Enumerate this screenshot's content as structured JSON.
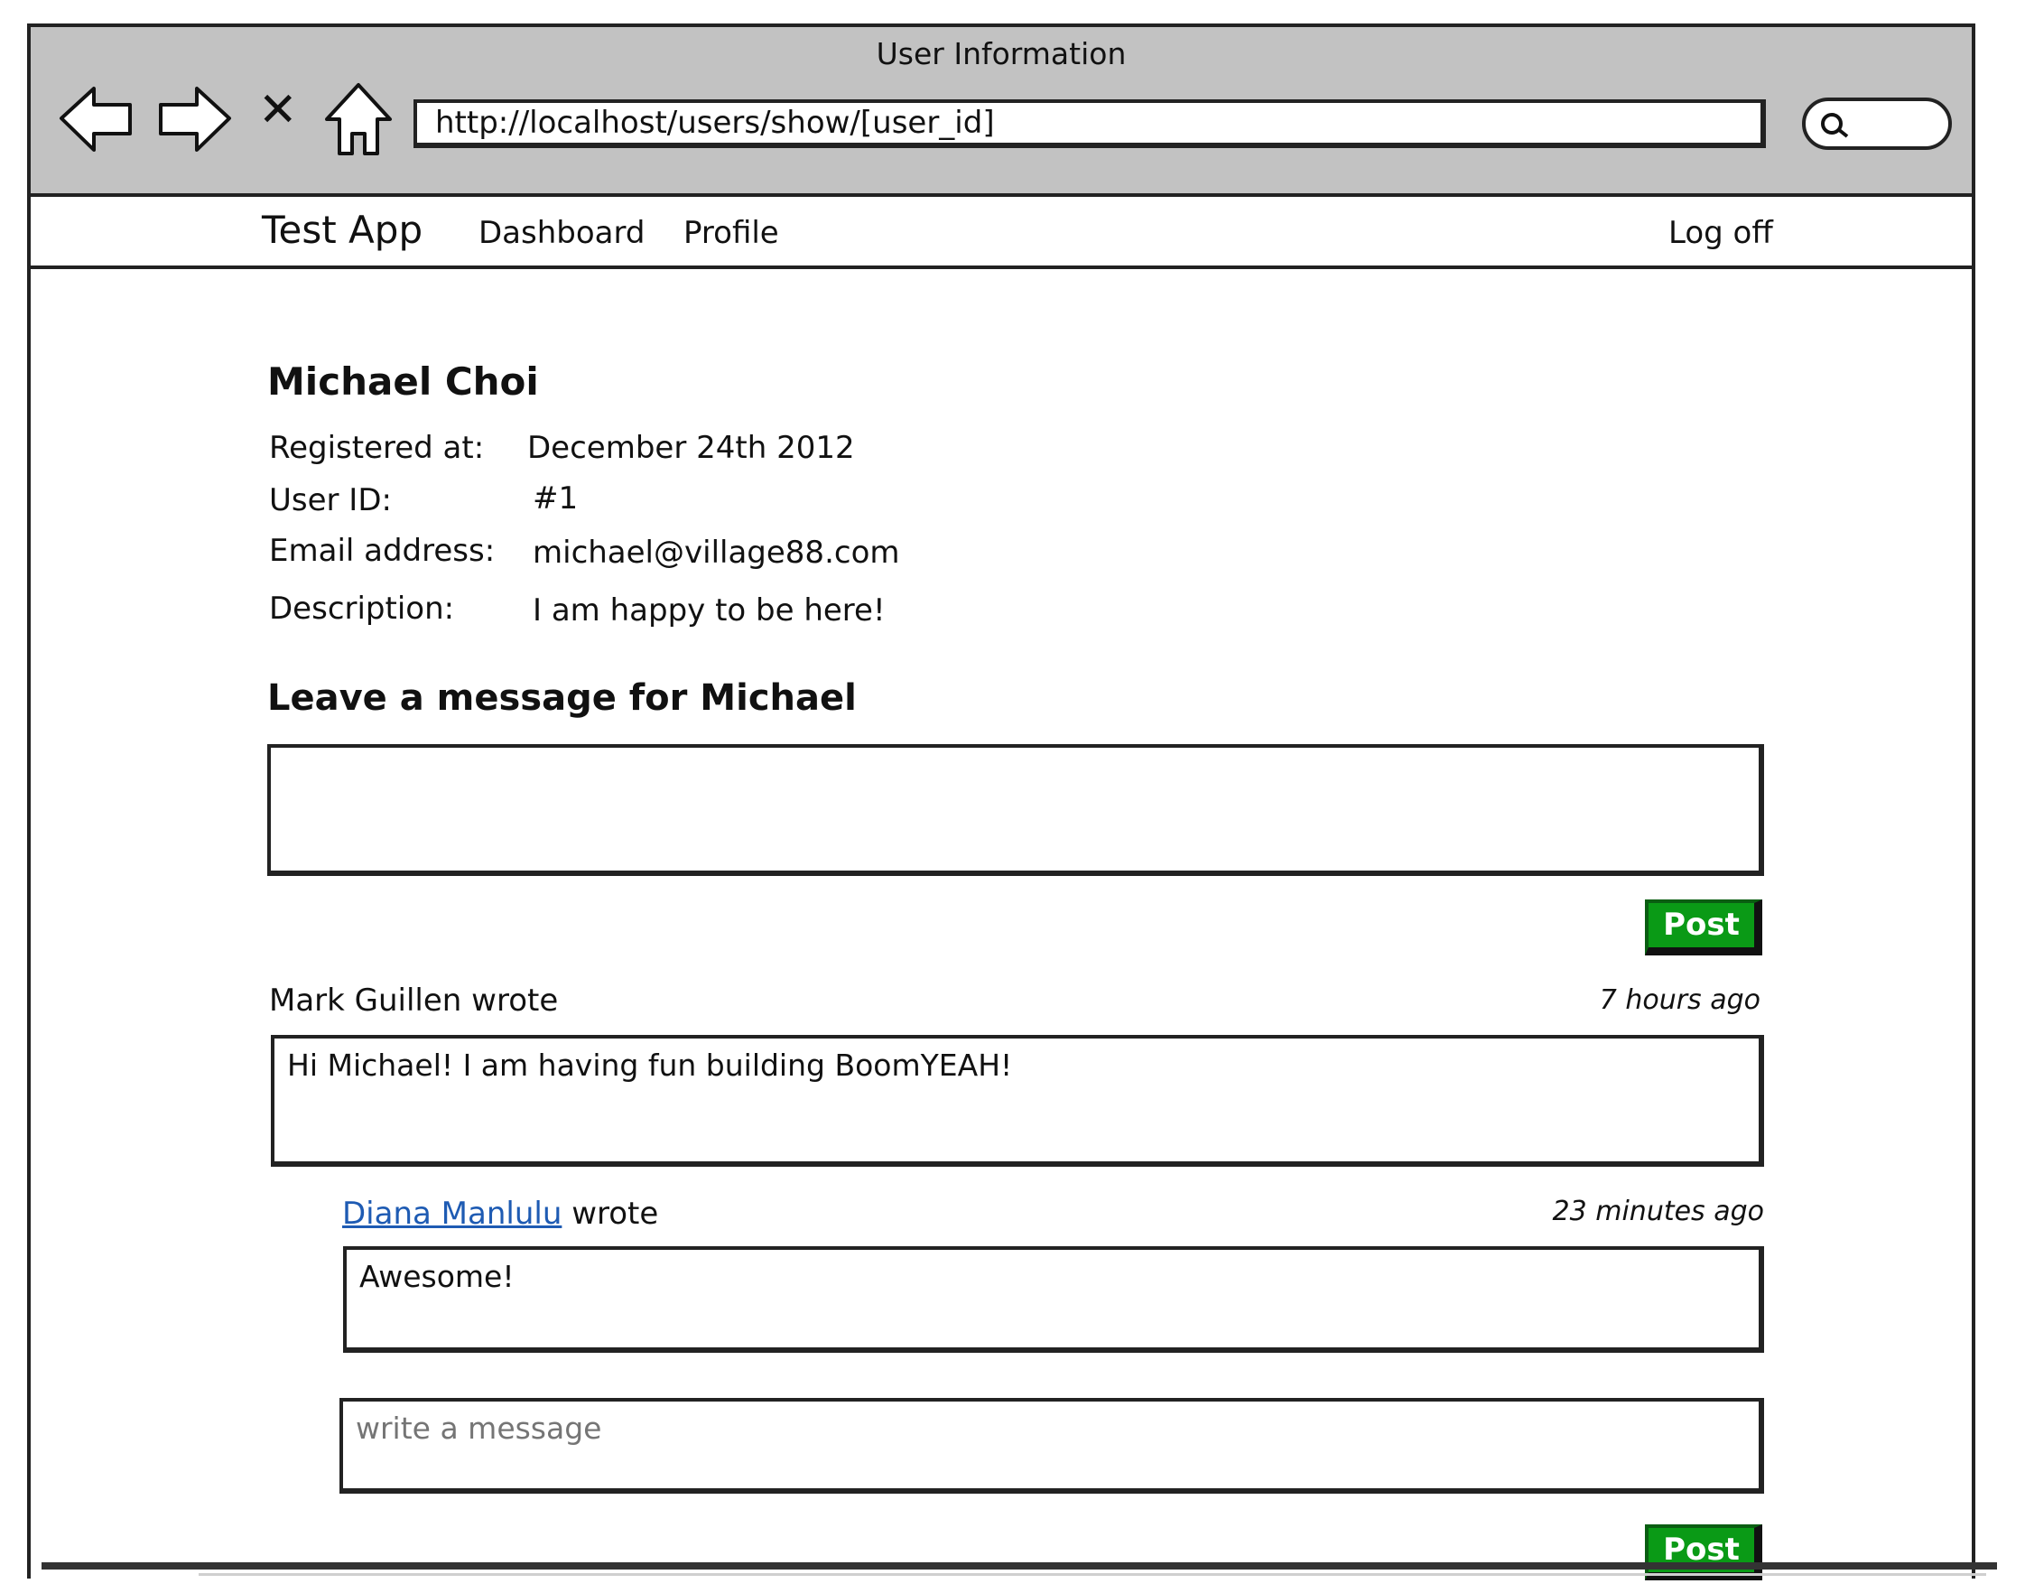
{
  "browser": {
    "window_title": "User Information",
    "url": "http://localhost/users/show/[user_id]",
    "icons": [
      "back-arrow-icon",
      "forward-arrow-icon",
      "close-icon",
      "home-icon",
      "search-icon"
    ]
  },
  "navbar": {
    "brand": "Test App",
    "links": [
      "Dashboard",
      "Profile"
    ],
    "logoff": "Log off"
  },
  "user": {
    "name": "Michael Choi",
    "fields": [
      {
        "label": "Registered at:",
        "value": "December 24th 2012"
      },
      {
        "label": "User ID:",
        "value": "#1"
      },
      {
        "label": "Email address:",
        "value": "michael@village88.com"
      },
      {
        "label": "Description:",
        "value": "I am happy to be here!"
      }
    ]
  },
  "message_form": {
    "heading": "Leave a message for Michael",
    "value": "",
    "post_label": "Post"
  },
  "messages": [
    {
      "author": "Mark Guillen",
      "wrote": "wrote",
      "time": "7 hours ago",
      "text": "Hi Michael! I am having fun building BoomYEAH!",
      "comments": [
        {
          "author": "Diana Manlulu",
          "wrote": "wrote",
          "time": "23 minutes ago",
          "text": "Awesome!"
        }
      ],
      "reply": {
        "placeholder": "write a message",
        "post_label": "Post"
      }
    }
  ],
  "colors": {
    "chrome": "#c2c2c2",
    "post_button": "#0a9a16",
    "link": "#1e5bb3"
  }
}
